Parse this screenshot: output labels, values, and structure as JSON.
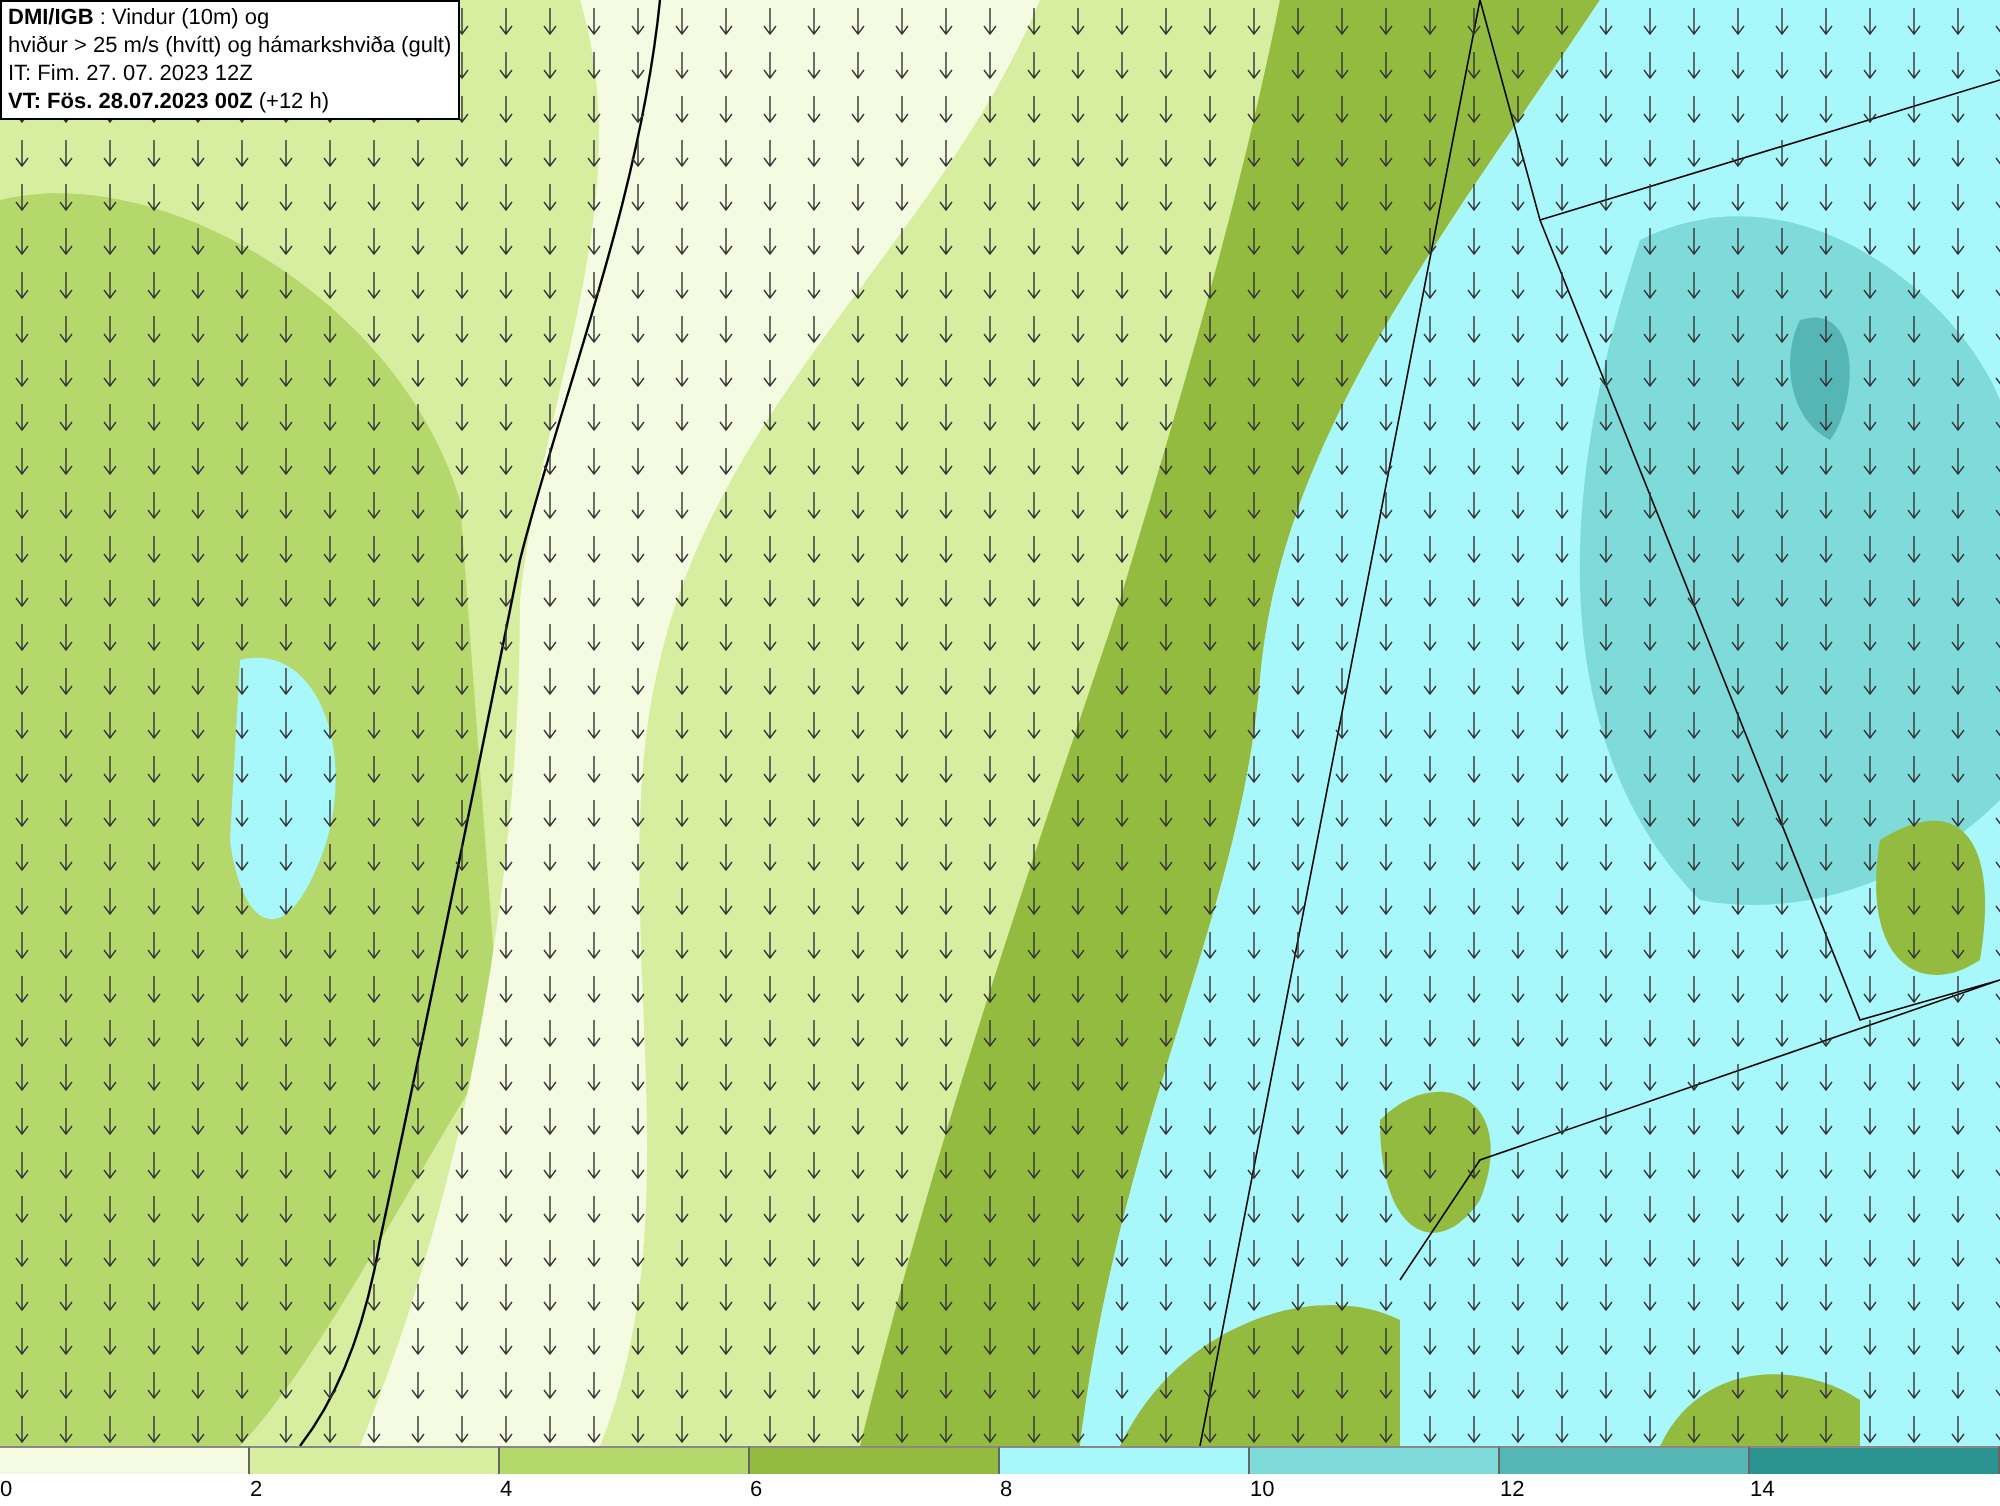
{
  "title_box": {
    "lines": [
      "**DMI/IGB** : Vindur (10m) og",
      "hviður > 25 m/s (hvítt) og hámarkshviða (gult)",
      "IT: Fim. 27. 07. 2023 12Z",
      "**VT: Fös. 28.07.2023 00Z** (+12 h)"
    ]
  },
  "legend": {
    "segments": [
      {
        "label": "0",
        "color": "#f4fbe0"
      },
      {
        "label": "2",
        "color": "#d7eda0"
      },
      {
        "label": "4",
        "color": "#b5d86c"
      },
      {
        "label": "6",
        "color": "#93bb3f"
      },
      {
        "label": "8",
        "color": "#a8f7fb"
      },
      {
        "label": "10",
        "color": "#7fdada"
      },
      {
        "label": "12",
        "color": "#56b6b6"
      },
      {
        "label": "14",
        "color": "#2b9490"
      }
    ]
  }
}
